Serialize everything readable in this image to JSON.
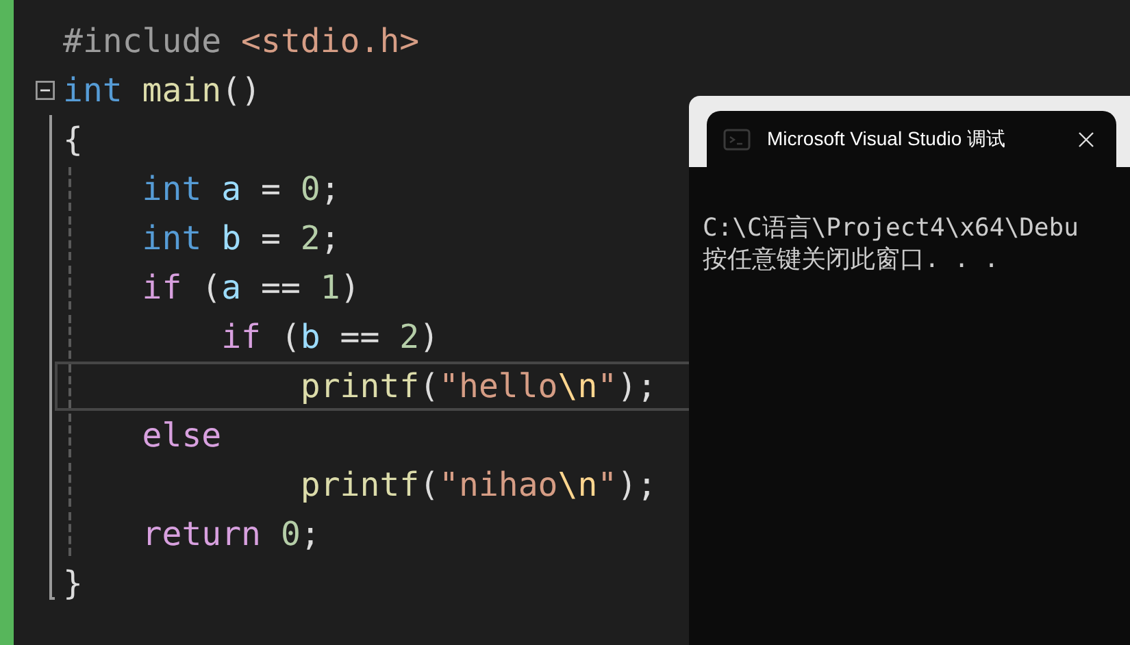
{
  "editor": {
    "lines": [
      {
        "current": false,
        "tokens": [
          {
            "kind": "preproc",
            "text": "#include"
          },
          {
            "kind": "path",
            "text": " <stdio.h>"
          }
        ]
      },
      {
        "expanded": true,
        "current": false,
        "tokens": [
          {
            "kind": "keyword",
            "text": "int"
          },
          {
            "kind": "function",
            "text": " main"
          },
          {
            "kind": "punct",
            "text": "()"
          }
        ]
      },
      {
        "current": false,
        "tokens": [
          {
            "kind": "punct",
            "text": "{"
          }
        ]
      },
      {
        "current": false,
        "tokens": [
          {
            "kind": "keyword",
            "text": "    int"
          },
          {
            "kind": "variable",
            "text": " a"
          },
          {
            "kind": "punct",
            "text": " = "
          },
          {
            "kind": "number",
            "text": "0"
          },
          {
            "kind": "punct",
            "text": ";"
          }
        ]
      },
      {
        "current": false,
        "tokens": [
          {
            "kind": "keyword",
            "text": "    int"
          },
          {
            "kind": "variable",
            "text": " b"
          },
          {
            "kind": "punct",
            "text": " = "
          },
          {
            "kind": "number",
            "text": "2"
          },
          {
            "kind": "punct",
            "text": ";"
          }
        ]
      },
      {
        "current": false,
        "tokens": [
          {
            "kind": "control",
            "text": "    if"
          },
          {
            "kind": "punct",
            "text": " ("
          },
          {
            "kind": "variable",
            "text": "a"
          },
          {
            "kind": "punct",
            "text": " == "
          },
          {
            "kind": "number",
            "text": "1"
          },
          {
            "kind": "punct",
            "text": ")"
          }
        ]
      },
      {
        "current": false,
        "tokens": [
          {
            "kind": "control",
            "text": "        if"
          },
          {
            "kind": "punct",
            "text": " ("
          },
          {
            "kind": "variable",
            "text": "b"
          },
          {
            "kind": "punct",
            "text": " == "
          },
          {
            "kind": "number",
            "text": "2"
          },
          {
            "kind": "punct",
            "text": ")"
          }
        ]
      },
      {
        "current": true,
        "tokens": [
          {
            "kind": "function",
            "text": "            printf"
          },
          {
            "kind": "punct",
            "text": "("
          },
          {
            "kind": "string",
            "text": "\"hello"
          },
          {
            "kind": "escape",
            "text": "\\n"
          },
          {
            "kind": "string",
            "text": "\""
          },
          {
            "kind": "punct",
            "text": ");"
          }
        ]
      },
      {
        "current": false,
        "tokens": [
          {
            "kind": "control",
            "text": "    else"
          }
        ]
      },
      {
        "current": false,
        "tokens": [
          {
            "kind": "function",
            "text": "            printf"
          },
          {
            "kind": "punct",
            "text": "("
          },
          {
            "kind": "string",
            "text": "\"nihao"
          },
          {
            "kind": "escape",
            "text": "\\n"
          },
          {
            "kind": "string",
            "text": "\""
          },
          {
            "kind": "punct",
            "text": ");"
          }
        ]
      },
      {
        "current": false,
        "tokens": [
          {
            "kind": "control",
            "text": "    return"
          },
          {
            "kind": "number",
            "text": " 0"
          },
          {
            "kind": "punct",
            "text": ";"
          }
        ]
      },
      {
        "current": false,
        "tokens": [
          {
            "kind": "punct",
            "text": "}"
          }
        ]
      }
    ]
  },
  "console": {
    "title": "Microsoft Visual Studio 调试",
    "output": [
      "C:\\C语言\\Project4\\x64\\Debu",
      "按任意键关闭此窗口. . ."
    ]
  }
}
